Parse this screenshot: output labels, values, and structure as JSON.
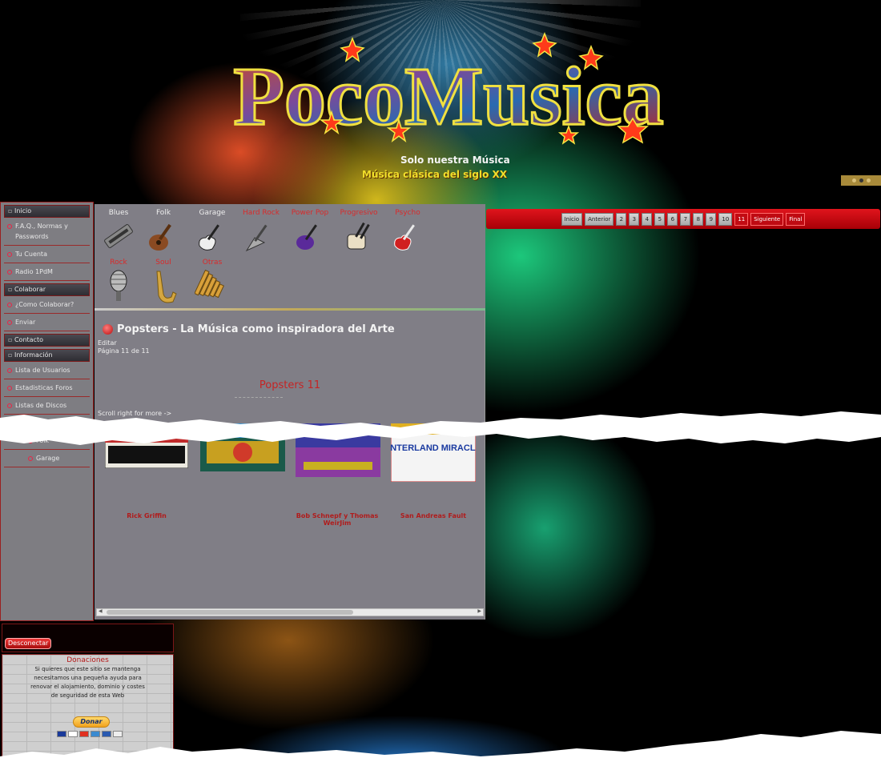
{
  "header": {
    "logo_text": "PocoMusica",
    "tagline": "Solo nuestra Música",
    "subtitle": "Música clásica del siglo XX"
  },
  "sidebar": {
    "sections": [
      {
        "title": "Inicio",
        "items": [
          "F.A.Q., Normas y Passwords",
          "Tu Cuenta",
          "Radio 1PdM"
        ]
      },
      {
        "title": "Colaborar",
        "items": [
          "¿Como Colaborar?",
          "Enviar"
        ]
      },
      {
        "title": "Contacto",
        "items": []
      },
      {
        "title": "Información",
        "items": [
          "Lista de Usuarios",
          "Estadisticas Foros",
          "Listas de Discos"
        ]
      }
    ],
    "sub_items": [
      "Blues",
      "Folk",
      "Garage"
    ]
  },
  "genres": [
    {
      "label": "Blues",
      "icon": "harmonica-icon"
    },
    {
      "label": "Folk",
      "icon": "acoustic-guitar-icon"
    },
    {
      "label": "Garage",
      "icon": "electric-guitar-icon"
    },
    {
      "label": "Hard Rock",
      "icon": "flying-v-guitar-icon"
    },
    {
      "label": "Power Pop",
      "icon": "purple-guitar-icon"
    },
    {
      "label": "Progresivo",
      "icon": "double-neck-guitar-icon"
    },
    {
      "label": "Psycho",
      "icon": "red-bass-icon"
    },
    {
      "label": "Rock",
      "icon": "microphone-icon"
    },
    {
      "label": "Soul",
      "icon": "saxophone-icon"
    },
    {
      "label": "Otras",
      "icon": "pan-flute-icon"
    }
  ],
  "main": {
    "title": "Popsters - La Música como inspiradora del Arte",
    "edit": "Editar",
    "page_info": "Página 11 de 11",
    "heading": "Popsters 11",
    "scroll_hint": "Scroll right for more ->",
    "posters": [
      {
        "caption": "Rick Griffin"
      },
      {
        "caption": ""
      },
      {
        "caption": "Bob Schnepf y Thomas WeirJim"
      },
      {
        "caption": "San Andreas Fault",
        "poster_text": "WINTERLAND MIRACLES"
      }
    ]
  },
  "pager": {
    "first": "Inicio",
    "prev": "Anterior",
    "pages": [
      "2",
      "3",
      "4",
      "5",
      "6",
      "7",
      "8",
      "9",
      "10"
    ],
    "current": "11",
    "next": "Siguiente",
    "last": "Final"
  },
  "widgets": {
    "logout": "Desconectar",
    "donate_title": "Donaciones",
    "donate_text": "Si quieres que este sitio se mantenga necesitamos una pequeña ayuda para renovar el alojamiento, dominio y costes de seguridad de esta Web",
    "donate_button": "Donar"
  },
  "colors": {
    "accent": "#c52424",
    "panel": "#807e86"
  }
}
